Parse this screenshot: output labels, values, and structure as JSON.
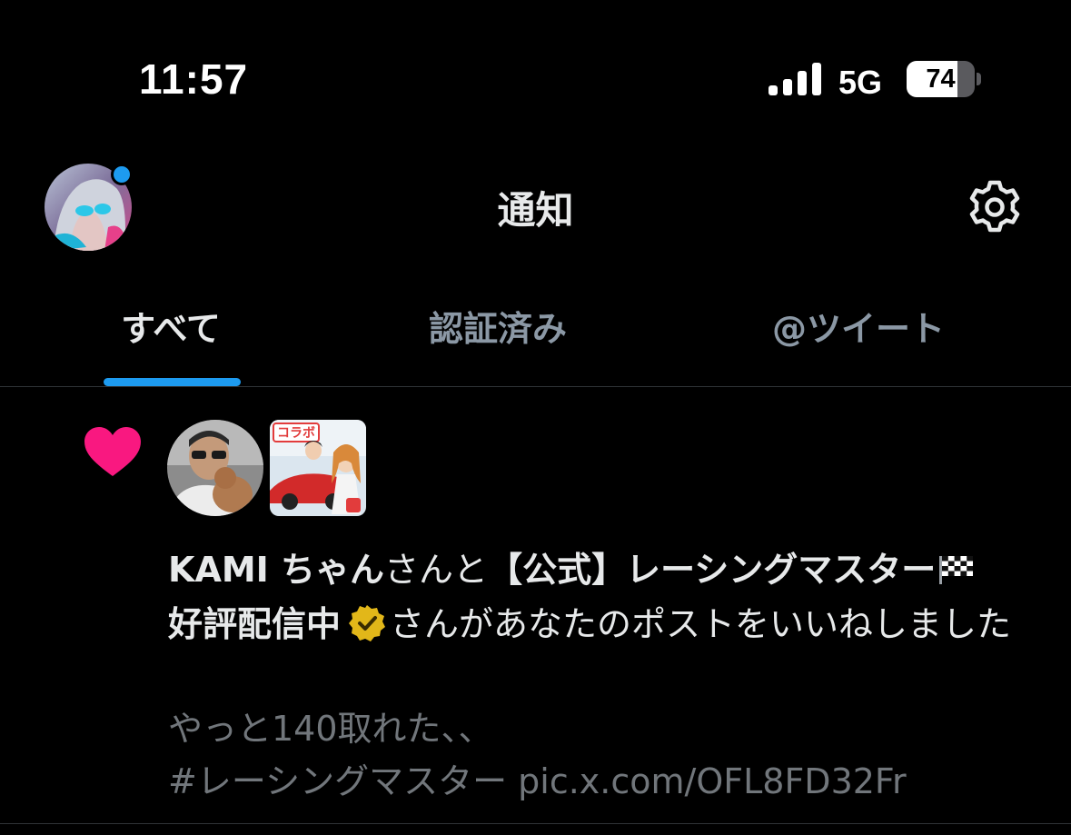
{
  "status_bar": {
    "time": "11:57",
    "network": "5G",
    "battery_level": "74",
    "battery_fraction": 0.74,
    "signal_bars": 4
  },
  "header": {
    "title": "通知",
    "profile_avatar_icon": "profile-avatar",
    "settings_icon": "gear-icon",
    "unread_dot_color": "#1d9bf0"
  },
  "tabs": [
    {
      "label": "すべて",
      "active": true
    },
    {
      "label": "認証済み",
      "active": false
    },
    {
      "label": "@ツイート",
      "active": false
    }
  ],
  "notification": {
    "type_icon": "heart-icon",
    "type_color": "#f91880",
    "actor1_name": "KAMI ちゃん",
    "joiner1": "さんと",
    "actor2_name": "【公式】レーシングマスター",
    "actor2_name_suffix": "好評配信中",
    "actor2_flag_icon": "checkered-flag-icon",
    "actor2_badge_icon": "verified-gold-badge-icon",
    "message": "さんがあなたのポストをいいねしました",
    "post_text": "やっと140取れた、、\n #レーシングマスター pic.x.com/OFL8FD32Fr",
    "actor2_avatar_label": "コラボ"
  },
  "colors": {
    "background": "#000000",
    "accent": "#1d9bf0",
    "like": "#f91880",
    "muted_text": "#71767b",
    "tab_inactive": "#8b98a5"
  }
}
